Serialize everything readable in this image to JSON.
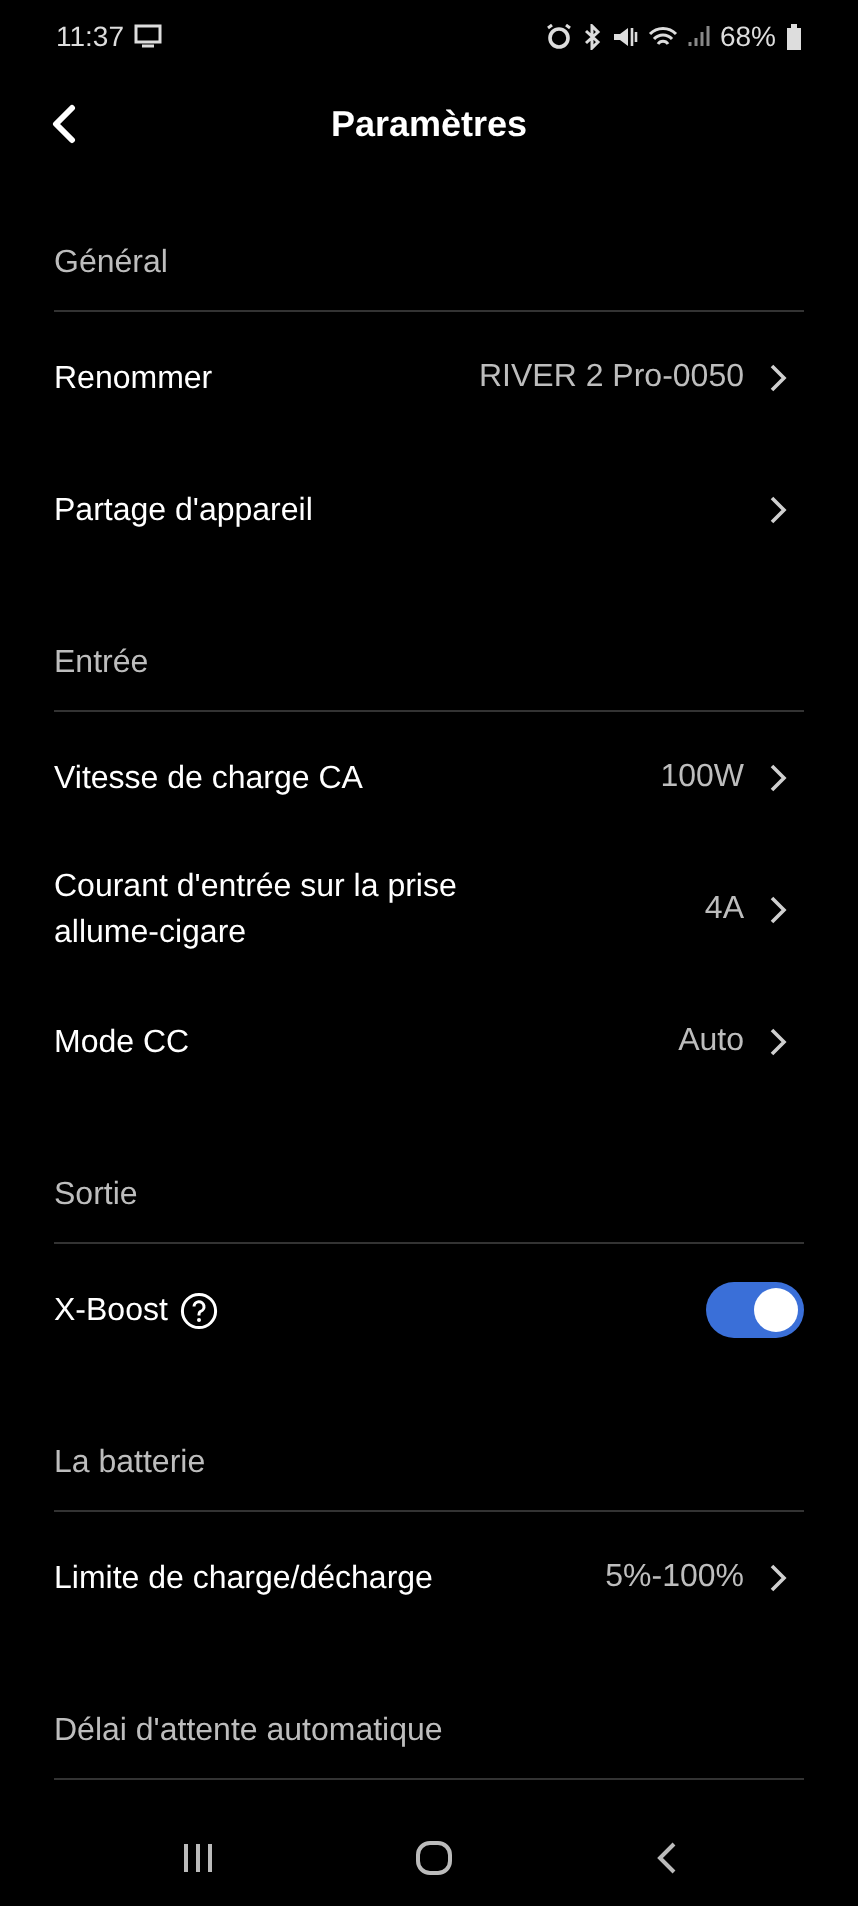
{
  "status_bar": {
    "time": "11:37",
    "battery": "68%"
  },
  "header": {
    "title": "Paramètres"
  },
  "sections": [
    {
      "title": "Général",
      "items": [
        {
          "kind": "link",
          "label": "Renommer",
          "value": "RIVER 2 Pro-0050"
        },
        {
          "kind": "link",
          "label": "Partage d'appareil"
        }
      ]
    },
    {
      "title": "Entrée",
      "items": [
        {
          "kind": "link",
          "label": "Vitesse de charge CA",
          "value": "100W"
        },
        {
          "kind": "link",
          "label": "Courant d'entrée sur la prise allume-cigare",
          "value": "4A"
        },
        {
          "kind": "link",
          "label": "Mode CC",
          "value": "Auto"
        }
      ]
    },
    {
      "title": "Sortie",
      "items": [
        {
          "kind": "toggle",
          "label": "X-Boost",
          "help": true,
          "on": true
        }
      ]
    },
    {
      "title": "La batterie",
      "items": [
        {
          "kind": "link",
          "label": "Limite de charge/décharge",
          "value": "5%-100%"
        }
      ]
    },
    {
      "title": "Délai d'attente automatique"
    }
  ]
}
